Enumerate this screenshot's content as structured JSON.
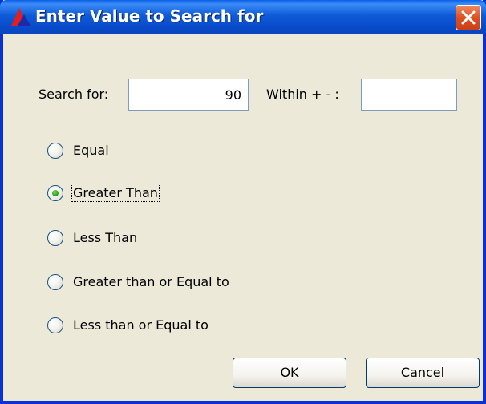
{
  "window": {
    "title": "Enter Value to Search for"
  },
  "icons": {
    "app": "app-icon",
    "close": "close-icon"
  },
  "search": {
    "label": "Search for:",
    "value": "90"
  },
  "within": {
    "label": "Within + - :",
    "value": ""
  },
  "options": [
    {
      "label": "Equal",
      "checked": false
    },
    {
      "label": "Greater Than",
      "checked": true
    },
    {
      "label": "Less Than",
      "checked": false
    },
    {
      "label": "Greater than or Equal to",
      "checked": false
    },
    {
      "label": "Less than or Equal to",
      "checked": false
    }
  ],
  "buttons": {
    "ok": "OK",
    "cancel": "Cancel"
  },
  "colors": {
    "titlebar": "#0a5fe6",
    "dialog_bg": "#ece9d8",
    "close": "#e0501e",
    "radio_selected": "#2aa61a"
  }
}
